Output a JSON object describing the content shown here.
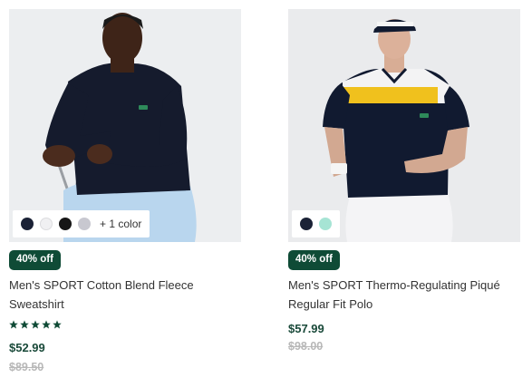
{
  "products": [
    {
      "title": "Men's SPORT Cotton Blend Fleece Sweatshirt",
      "discount_badge": "40% off",
      "price": "$52.99",
      "original_price": "$89.50",
      "rating_stars": 5,
      "swatches": [
        "navy",
        "white",
        "black",
        "grey"
      ],
      "more_colors": "+ 1 color"
    },
    {
      "title": "Men's SPORT Thermo-Regulating Piqué Regular Fit Polo",
      "discount_badge": "40% off",
      "price": "$57.99",
      "original_price": "$98.00",
      "swatches": [
        "navy",
        "mint"
      ]
    }
  ],
  "colors": {
    "badge_bg": "#0f4b36",
    "price_text": "#1a4a3a",
    "original_price_text": "#b8b8b8",
    "star_color": "#0f4b36"
  }
}
